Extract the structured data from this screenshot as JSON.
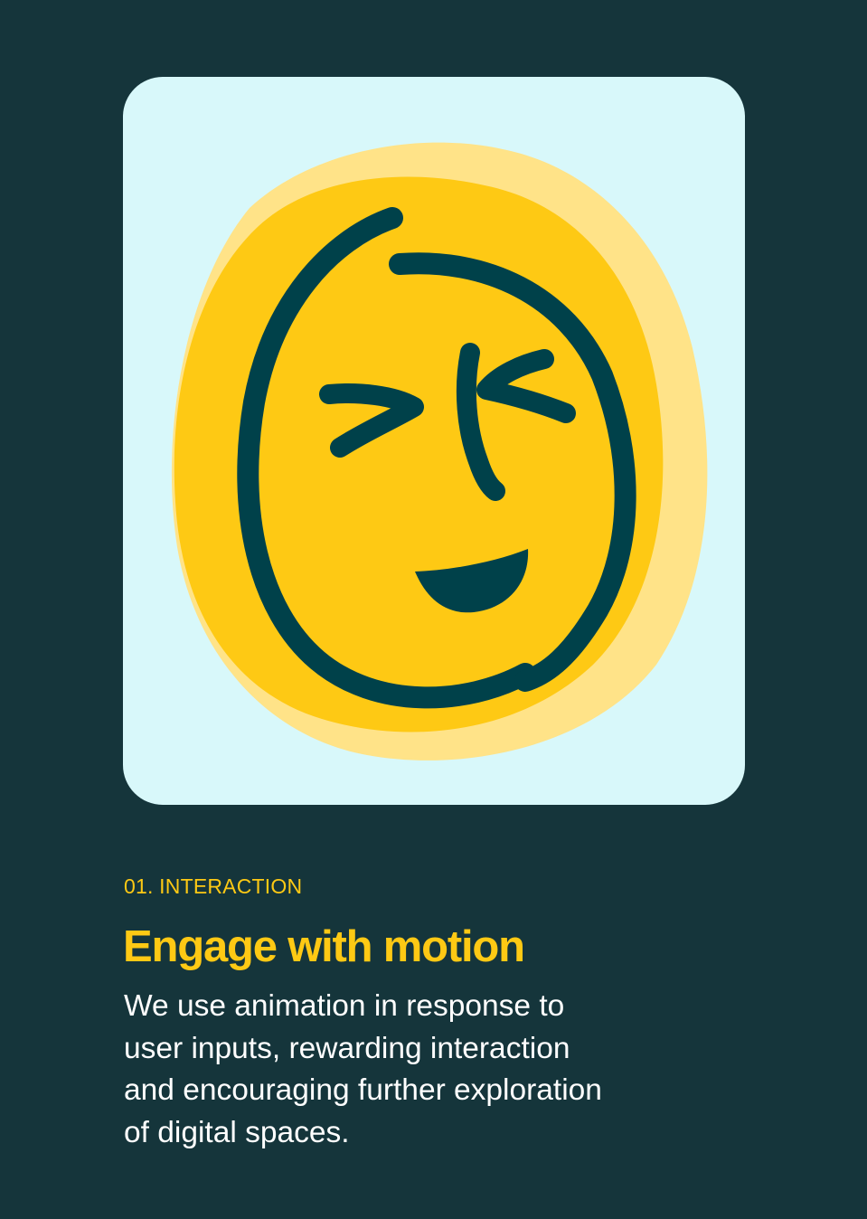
{
  "illustration": {
    "icon": "winking-smiley-face-icon",
    "colors": {
      "background": "#d8f8fa",
      "face_fill": "#fec914",
      "face_shadow": "#ffe388",
      "face_outline": "#00414a"
    }
  },
  "section": {
    "eyebrow": "01. INTERACTION",
    "headline": "Engage with motion",
    "body_lines": [
      "We use animation in response to",
      "user inputs, rewarding interaction",
      "and encouraging further exploration",
      "of digital spaces."
    ]
  },
  "colors": {
    "page_background": "#15353b",
    "accent": "#fec914",
    "body_text": "#ffffff"
  }
}
